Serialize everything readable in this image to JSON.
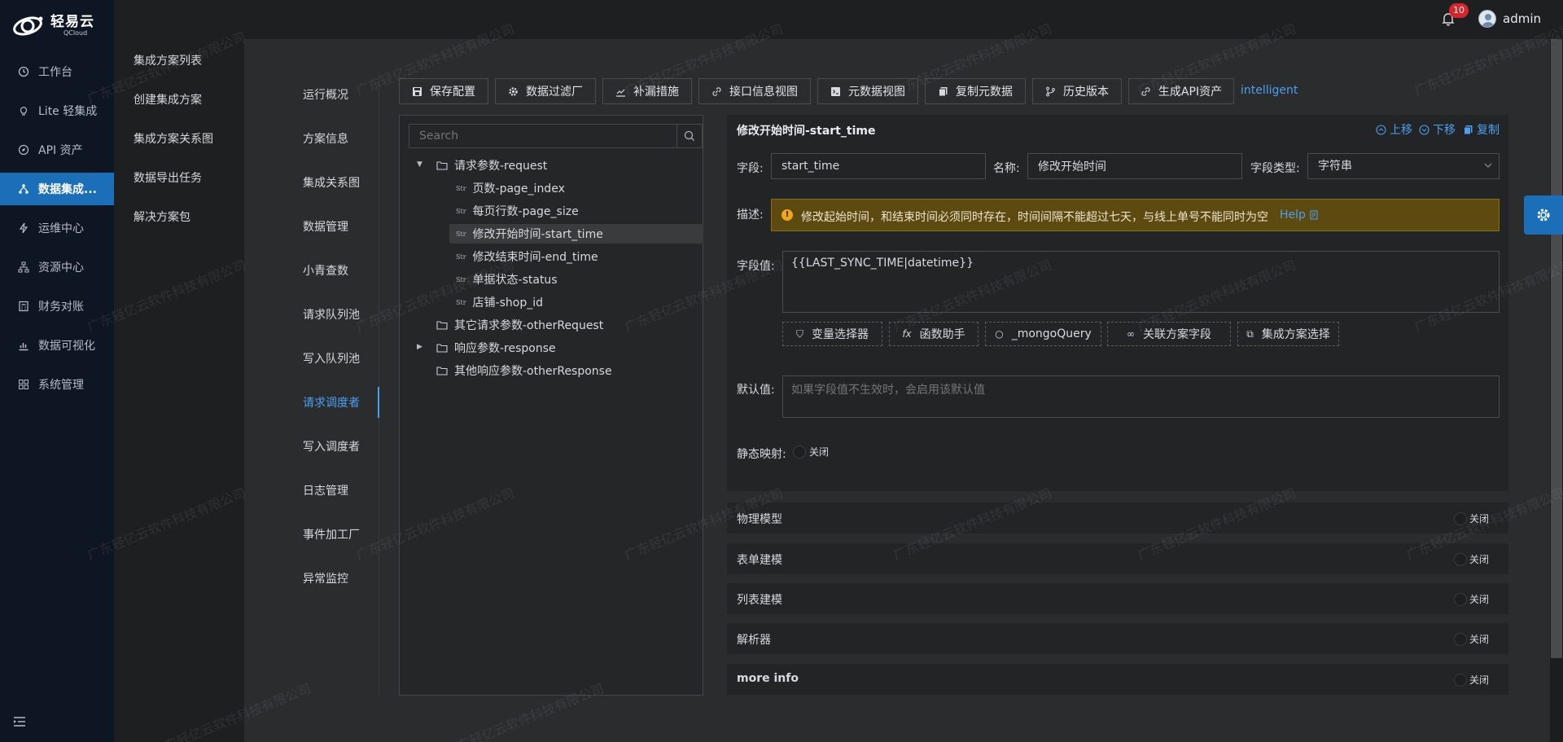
{
  "brand": {
    "name": "轻易云",
    "sub": "QCloud"
  },
  "leftnav": {
    "items": [
      {
        "label": "工作台",
        "icon": "dashboard-icon"
      },
      {
        "label": "Lite 轻集成",
        "icon": "bulb-icon"
      },
      {
        "label": "API 资产",
        "icon": "compass-icon"
      },
      {
        "label": "数据集成...",
        "icon": "cluster-icon",
        "active": true
      },
      {
        "label": "运维中心",
        "icon": "thunder-icon"
      },
      {
        "label": "资源中心",
        "icon": "apartment-icon"
      },
      {
        "label": "财务对账",
        "icon": "calculator-icon"
      },
      {
        "label": "数据可视化",
        "icon": "chart-icon"
      },
      {
        "label": "系统管理",
        "icon": "grid-icon"
      }
    ]
  },
  "subnav": {
    "items": [
      "集成方案列表",
      "创建集成方案",
      "集成方案关系图",
      "数据导出任务",
      "解决方案包"
    ]
  },
  "topbar": {
    "notifications": "10",
    "user": "admin"
  },
  "sections": {
    "items": [
      "运行概况",
      "方案信息",
      "集成关系图",
      "数据管理",
      "小青查数",
      "请求队列池",
      "写入队列池",
      "请求调度者",
      "写入调度者",
      "日志管理",
      "事件加工厂",
      "异常监控"
    ],
    "active_index": 7
  },
  "toolbar": {
    "buttons": [
      {
        "label": "保存配置",
        "icon": "save-icon"
      },
      {
        "label": "数据过滤厂",
        "icon": "gear-icon"
      },
      {
        "label": "补漏措施",
        "icon": "stock-icon"
      },
      {
        "label": "接口信息视图",
        "icon": "link-icon"
      },
      {
        "label": "元数据视图",
        "icon": "code-icon"
      },
      {
        "label": "复制元数据",
        "icon": "copy-icon"
      },
      {
        "label": "历史版本",
        "icon": "branch-icon"
      },
      {
        "label": "生成API资产",
        "icon": "link-icon"
      }
    ],
    "link": "intelligent"
  },
  "tree": {
    "search_placeholder": "Search",
    "nodes": [
      {
        "label": "请求参数-request",
        "type": "folder",
        "expanded": true
      },
      {
        "label": "页数-page_index",
        "type": "str"
      },
      {
        "label": "每页行数-page_size",
        "type": "str"
      },
      {
        "label": "修改开始时间-start_time",
        "type": "str",
        "selected": true
      },
      {
        "label": "修改结束时间-end_time",
        "type": "str"
      },
      {
        "label": "单据状态-status",
        "type": "str"
      },
      {
        "label": "店铺-shop_id",
        "type": "str"
      },
      {
        "label": "其它请求参数-otherRequest",
        "type": "folder"
      },
      {
        "label": "响应参数-response",
        "type": "folder",
        "expandable": true
      },
      {
        "label": "其他响应参数-otherResponse",
        "type": "folder"
      }
    ],
    "str_tag": "Str"
  },
  "form": {
    "title": "修改开始时间-start_time",
    "actions": {
      "up": "上移",
      "down": "下移",
      "copy": "复制"
    },
    "field_label": "字段:",
    "field_value": "start_time",
    "name_label": "名称:",
    "name_value": "修改开始时间",
    "type_label": "字段类型:",
    "type_value": "字符串",
    "desc_label": "描述:",
    "desc_value": "修改起始时间，和结束时间必须同时存在，时间间隔不能超过七天，与线上单号不能同时为空",
    "help": "Help",
    "value_label": "字段值:",
    "value_text": "{{LAST_SYNC_TIME|datetime}}",
    "helpers": [
      {
        "label": "变量选择器",
        "glyph": "⛉"
      },
      {
        "label": "函数助手",
        "glyph": "fx"
      },
      {
        "label": "_mongoQuery",
        "glyph": "○"
      },
      {
        "label": "关联方案字段",
        "glyph": "∞"
      },
      {
        "label": "集成方案选择",
        "glyph": "⧉"
      }
    ],
    "default_label": "默认值:",
    "default_placeholder": "如果字段值不生效时，会启用该默认值",
    "static_label": "静态映射:",
    "static_toggle": "关闭"
  },
  "collapsed": [
    {
      "label": "物理模型",
      "toggle": "关闭"
    },
    {
      "label": "表单建模",
      "toggle": "关闭"
    },
    {
      "label": "列表建模",
      "toggle": "关闭"
    },
    {
      "label": "解析器",
      "toggle": "关闭"
    },
    {
      "label": "more info",
      "toggle": "关闭"
    }
  ],
  "watermark": "广东轻亿云软件科技有限公司",
  "colors": {
    "accent": "#1a6fb8",
    "link": "#4aa0f0",
    "warn_bg": "#5c4a10",
    "badge": "#d6262b"
  }
}
